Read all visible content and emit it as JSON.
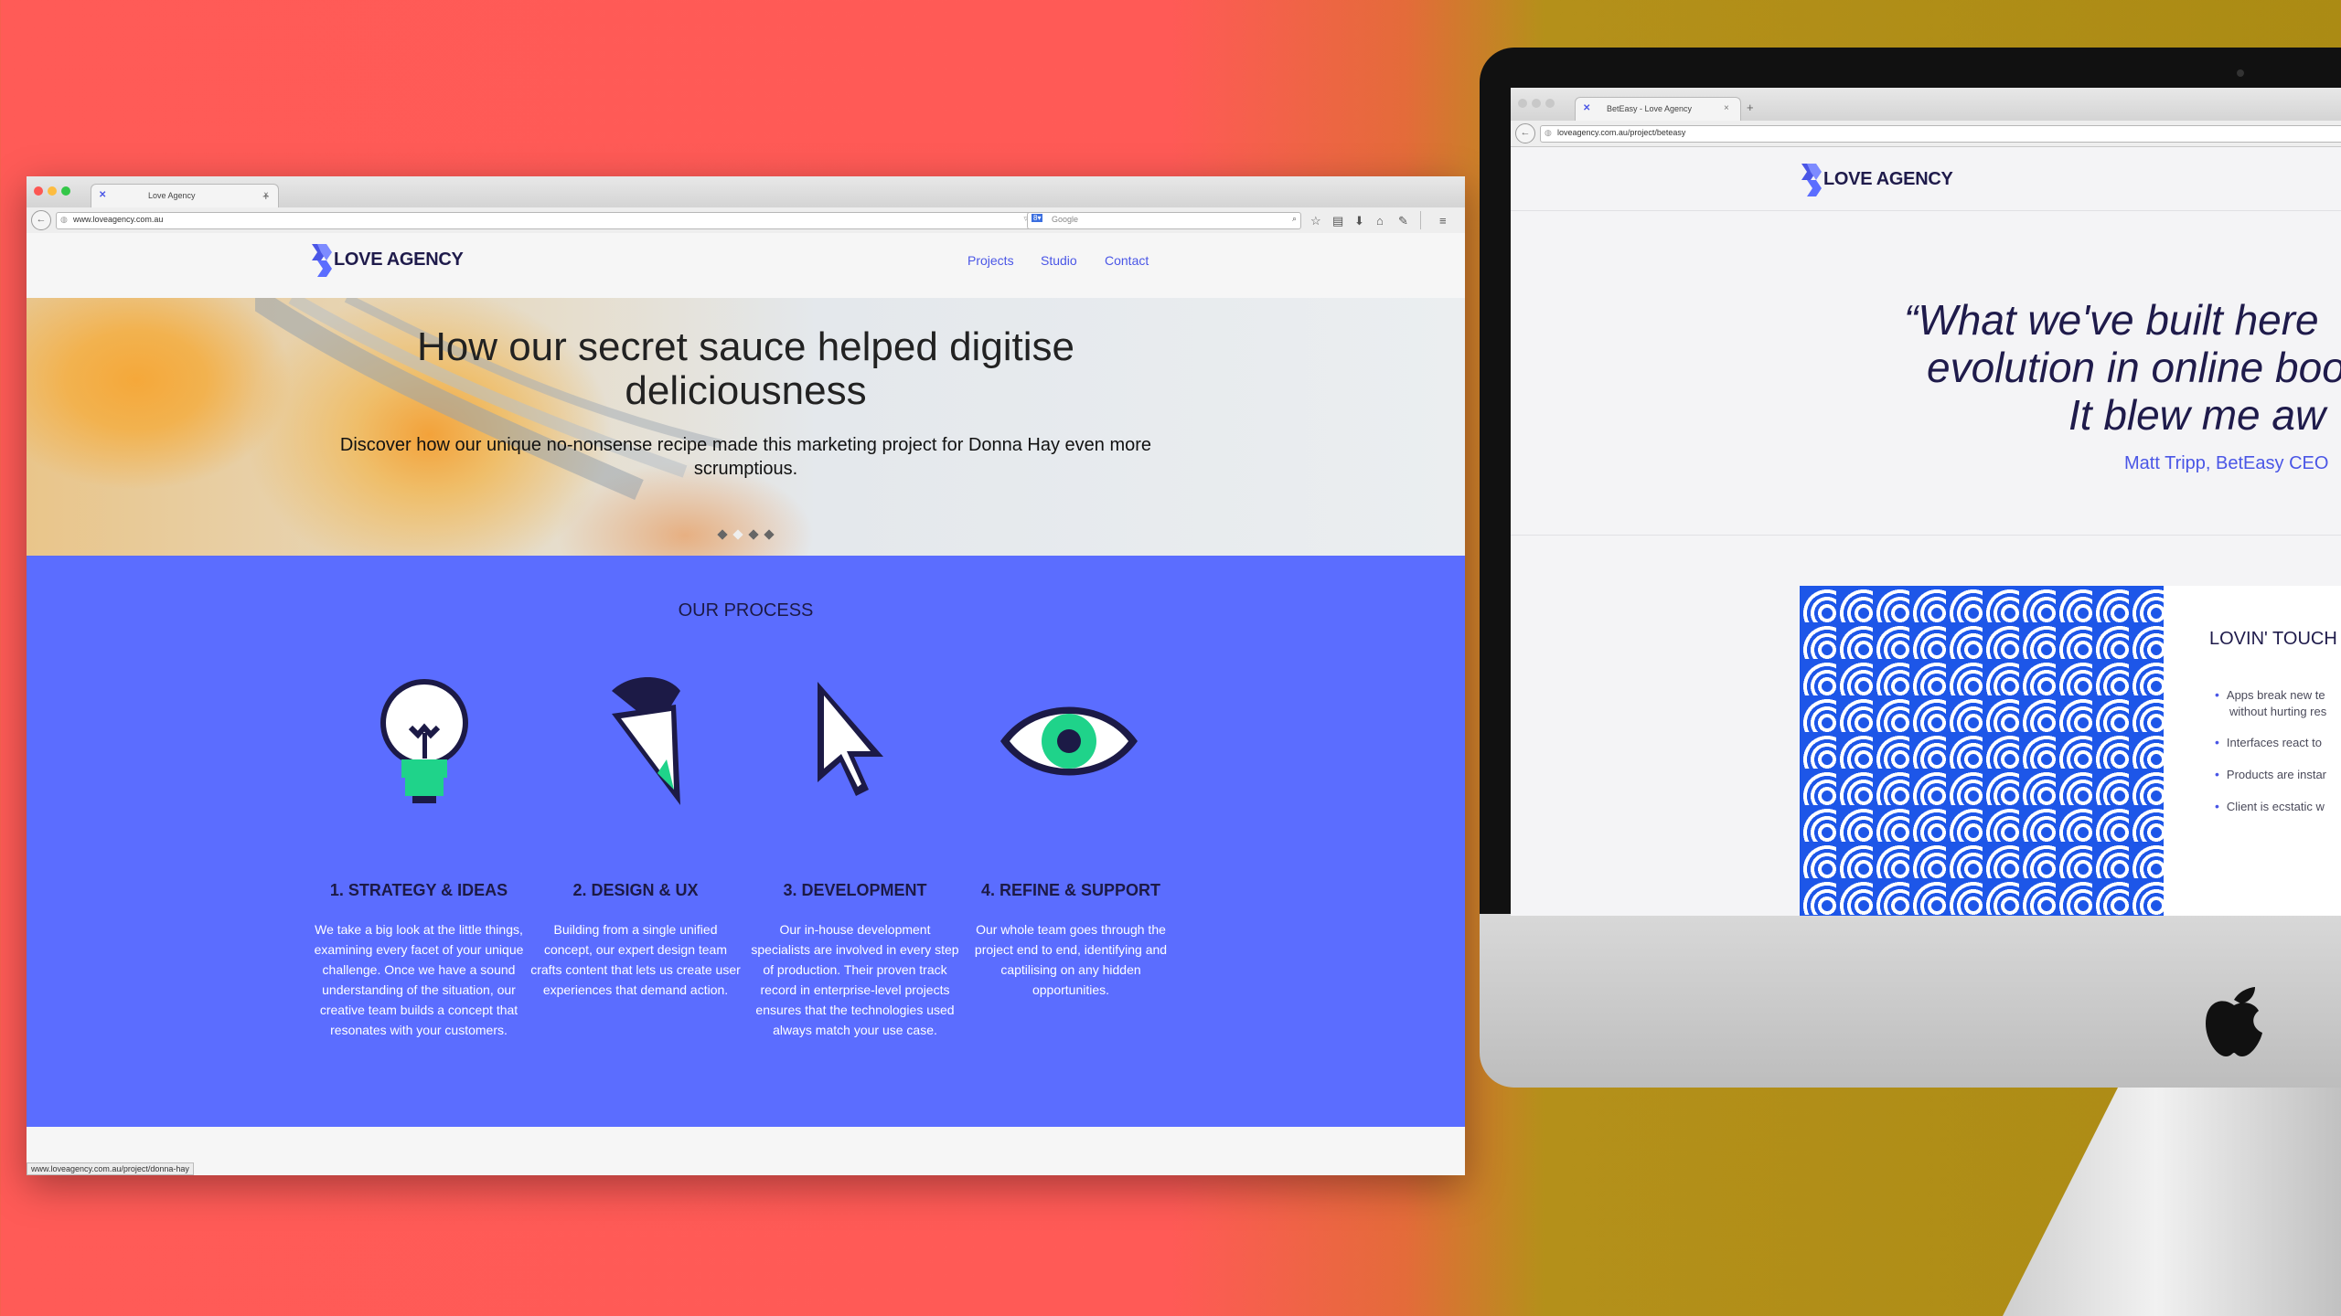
{
  "left_browser": {
    "tab_title": "Love Agency",
    "url": "www.loveagency.com.au",
    "search_placeholder": "Google",
    "status_url": "www.loveagency.com.au/project/donna-hay"
  },
  "site": {
    "logo_text": "LOVE AGENCY",
    "nav": [
      "Projects",
      "Studio",
      "Contact"
    ]
  },
  "hero": {
    "title": "How our secret sauce helped digitise deliciousness",
    "subtitle": "Discover how our unique no-nonsense recipe made this marketing project for Donna Hay even more scrumptious.",
    "active_slide": 2,
    "slide_count": 4
  },
  "process": {
    "title": "OUR PROCESS",
    "steps": [
      {
        "title": "1. STRATEGY & IDEAS",
        "icon": "lightbulb-icon",
        "text": "We take a big look at the little things, examining every facet of your unique challenge. Once we have a sound understanding of the situation, our creative team builds a concept that resonates with your customers."
      },
      {
        "title": "2. DESIGN & UX",
        "icon": "paintbrush-icon",
        "text": "Building from a single unified concept, our expert design team crafts content that lets us create user experiences that demand action."
      },
      {
        "title": "3. DEVELOPMENT",
        "icon": "cursor-icon",
        "text": "Our in-house development specialists are involved in every step of production. Their proven track record in enterprise-level projects ensures that the technologies used always match your use case."
      },
      {
        "title": "4. REFINE & SUPPORT",
        "icon": "eye-icon",
        "text": "Our whole team goes through the project end to end, identifying and captilising on any hidden opportunities."
      }
    ]
  },
  "right_browser": {
    "tab_title": "BetEasy - Love Agency",
    "url": "loveagency.com.au/project/beteasy",
    "logo_text": "LOVE AGENCY",
    "quote_lines": [
      "“What we've built here",
      "evolution in online boo",
      "It blew me aw"
    ],
    "author": "Matt Tripp, BetEasy CEO",
    "section_title": "LOVIN' TOUCH",
    "bullets": [
      "Apps break new te",
      "without hurting res",
      "Interfaces react to",
      "Products are instar",
      "Client is ecstatic w"
    ]
  },
  "colors": {
    "accent_blue": "#5b6dff",
    "dark_navy": "#1c1a46",
    "link_blue": "#4a56e6",
    "bg_red": "#ff5b57",
    "bg_gold": "#ab8b14",
    "pixel_green": "#1fd38a"
  }
}
